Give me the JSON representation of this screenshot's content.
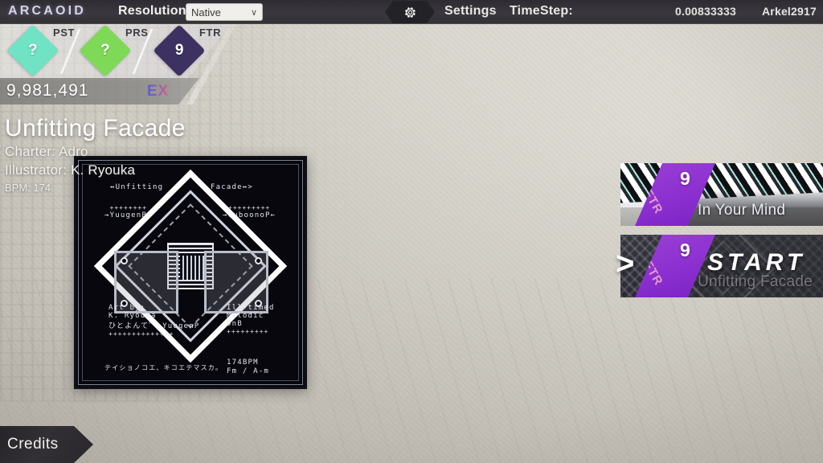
{
  "topbar": {
    "logo": "ARCAOID",
    "resolution_label": "Resolution:",
    "resolution_value": "Native",
    "chevron": "∨",
    "gear_icon": "gear-icon",
    "settings_label": "Settings",
    "timestep_label": "TimeStep:",
    "timestep_value": "0.00833333",
    "username": "Arkel2917"
  },
  "difficulty_panel": {
    "items": [
      {
        "name": "PST",
        "value": "?",
        "color": "#6fe3c4"
      },
      {
        "name": "PRS",
        "value": "?",
        "color": "#7ed957"
      },
      {
        "name": "FTR",
        "value": "9",
        "color": "#3c3160"
      }
    ],
    "score": "9,981,491",
    "grade": "EX"
  },
  "song_info": {
    "title": "Unfitting Facade",
    "charter": "Charter: Adro",
    "illustrator": "Illustrator: K. Ryouka",
    "bpm": "BPM: 174"
  },
  "jacket": {
    "top_left": "↔Unfitting",
    "top_right": "Facade↔>",
    "plus_left": "++++++++",
    "label_left": "→YuugenP←",
    "plus_right": "+++++++++",
    "label_right": "→CuboonoP←",
    "credit_left_1": "Art by:",
    "credit_left_2": "K. Ryouka",
    "credit_left_3": "ひとよんて゜ YuugenP",
    "credit_left_plus": "++++++++++++++",
    "credit_right_1": "Ill-timed",
    "credit_right_2": "Melodic",
    "credit_right_3": "DnB",
    "credit_right_plus": "+++++++++",
    "bottom_left": "テイショノコエ、キコエテマスカ。",
    "bottom_right_1": "174BPM",
    "bottom_right_2": "Fm / A-m"
  },
  "songlist": {
    "cursor_icon": "chevron-right-icon",
    "rows": [
      {
        "title": "In Your Mind",
        "level": "9",
        "difficulty": "FTR",
        "selected": false,
        "start_label": ""
      },
      {
        "title": "Unfitting Facade",
        "level": "9",
        "difficulty": "FTR",
        "selected": true,
        "start_label": "START"
      }
    ]
  },
  "credits": {
    "label": "Credits"
  },
  "colors": {
    "accent_purple": "#8b2fd0",
    "topbar_bg": "#343238",
    "grade_gradient_start": "#4a5bd6",
    "grade_gradient_end": "#e8607f"
  }
}
